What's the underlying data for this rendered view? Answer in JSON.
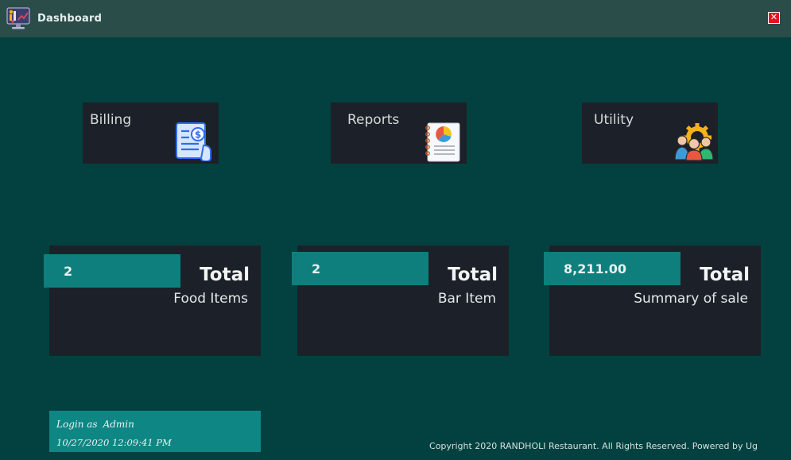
{
  "window": {
    "title": "Dashboard",
    "app_icon": "dashboard-monitor-icon",
    "close_icon": "close-icon",
    "close_symbol": "✕",
    "close_color": "#e81123"
  },
  "menu_tiles": [
    {
      "label": "Billing",
      "icon": "billing-invoice-icon"
    },
    {
      "label": "Reports",
      "icon": "reports-notebook-chart-icon"
    },
    {
      "label": "Utility",
      "icon": "utility-team-gear-icon"
    }
  ],
  "stats": [
    {
      "value": "2",
      "total_label": "Total",
      "sub_label": "Food Items"
    },
    {
      "value": "2",
      "total_label": "Total",
      "sub_label": "Bar Item"
    },
    {
      "value": "8,211.00",
      "total_label": "Total",
      "sub_label": "Summary of sale"
    }
  ],
  "login": {
    "prefix": "Login as",
    "user": "Admin",
    "datetime": "10/27/2020 12:09:41 PM"
  },
  "footer": {
    "copyright": "Copyright 2020 RANDHOLI Restaurant. All Rights Reserved. Powered by Ug"
  },
  "colors": {
    "background": "#02413f",
    "titlebar": "#2b4d4a",
    "tile": "#1c2129",
    "accent_teal": "#0e7f7d"
  }
}
